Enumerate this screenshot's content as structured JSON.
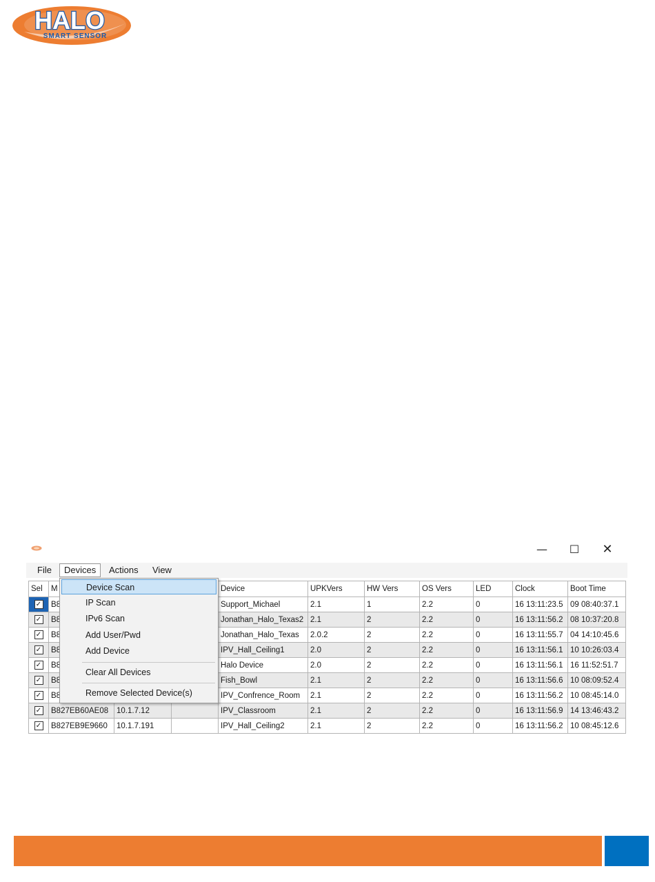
{
  "logo": {
    "word": "HALO",
    "tagline": "SMART SENSOR"
  },
  "window": {
    "controls": {
      "minimize": "—",
      "maximize": "☐",
      "close": "✕"
    }
  },
  "menubar": {
    "file": "File",
    "devices": "Devices",
    "actions": "Actions",
    "view": "View"
  },
  "dropdown": {
    "items": [
      "Device Scan",
      "IP Scan",
      "IPv6 Scan",
      "Add User/Pwd",
      "Add Device",
      "Clear All Devices",
      "Remove Selected Device(s)"
    ]
  },
  "grid": {
    "columns": [
      "Sel",
      "M",
      "",
      "",
      "Device",
      "UPKVers",
      "HW Vers",
      "OS Vers",
      "LED",
      "Clock",
      "Boot Time"
    ],
    "rows": [
      [
        "B8",
        "",
        "",
        "Support_Michael",
        "2.1",
        "1",
        "2.2",
        "0",
        "16 13:11:23.5",
        "09 08:40:37.1"
      ],
      [
        "B8",
        "",
        "",
        "Jonathan_Halo_Texas2",
        "2.1",
        "2",
        "2.2",
        "0",
        "16 13:11:56.2",
        "08 10:37:20.8"
      ],
      [
        "B8",
        "",
        "",
        "Jonathan_Halo_Texas",
        "2.0.2",
        "2",
        "2.2",
        "0",
        "16 13:11:55.7",
        "04 14:10:45.6"
      ],
      [
        "B8",
        "",
        "",
        "IPV_Hall_Ceiling1",
        "2.0",
        "2",
        "2.2",
        "0",
        "16 13:11:56.1",
        "10 10:26:03.4"
      ],
      [
        "B8",
        "",
        "",
        "Halo Device",
        "2.0",
        "2",
        "2.2",
        "0",
        "16 13:11:56.1",
        "16 11:52:51.7"
      ],
      [
        "B8",
        "",
        "",
        "Fish_Bowl",
        "2.1",
        "2",
        "2.2",
        "0",
        "16 13:11:56.6",
        "10 08:09:52.4"
      ],
      [
        "B8",
        "",
        "",
        "IPV_Confrence_Room",
        "2.1",
        "2",
        "2.2",
        "0",
        "16 13:11:56.2",
        "10 08:45:14.0"
      ],
      [
        "B827EB60AE08",
        "10.1.7.12",
        "",
        "IPV_Classroom",
        "2.1",
        "2",
        "2.2",
        "0",
        "16 13:11:56.9",
        "14 13:46:43.2"
      ],
      [
        "B827EB9E9660",
        "10.1.7.191",
        "",
        "IPV_Hall_Ceiling2",
        "2.1",
        "2",
        "2.2",
        "0",
        "16 13:11:56.2",
        "10 08:45:12.6"
      ]
    ]
  },
  "colors": {
    "orange": "#ed7d31",
    "blue": "#0070c0",
    "highlight": "#cce4f7"
  }
}
